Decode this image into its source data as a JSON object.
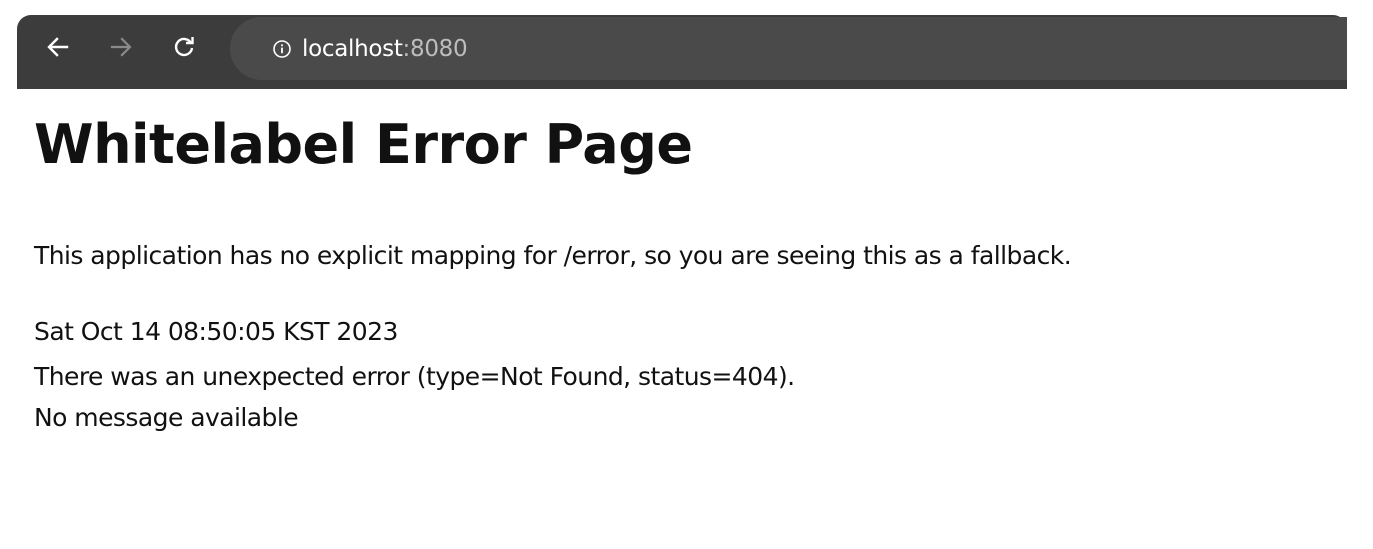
{
  "browser": {
    "url_host": "localhost",
    "url_port": ":8080",
    "icons": {
      "back": "arrow-left-icon",
      "forward": "arrow-right-icon",
      "reload": "reload-icon",
      "info": "info-circle-icon"
    }
  },
  "page": {
    "title": "Whitelabel Error Page",
    "description": "This application has no explicit mapping for /error, so you are seeing this as a fallback.",
    "timestamp": "Sat Oct 14 08:50:05 KST 2023",
    "error_detail": "There was an unexpected error (type=Not Found, status=404).",
    "message": "No message available"
  }
}
